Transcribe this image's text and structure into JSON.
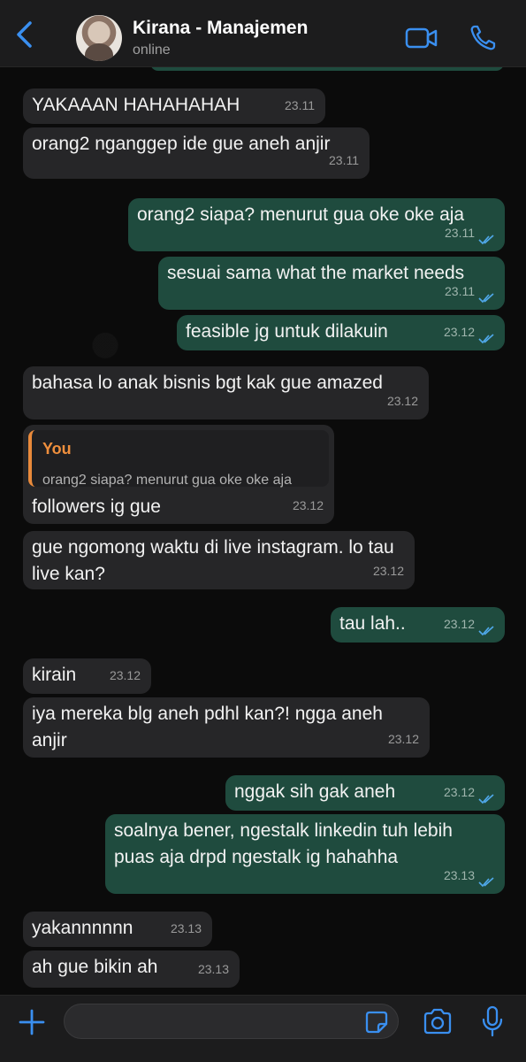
{
  "header": {
    "contact_name": "Kirana - Manajemen",
    "status": "online"
  },
  "colors": {
    "accent": "#3a8ff0",
    "incoming_bubble": "#262628",
    "outgoing_bubble": "#1f4b3e",
    "read_ticks": "#4fa7e8",
    "reply_accent": "#ef8f3d"
  },
  "messages": [
    {
      "dir": "in",
      "text": "YAKAAAN HAHAHAHAH",
      "time": "23.11"
    },
    {
      "dir": "in",
      "text": "orang2 nganggep ide gue aneh anjir",
      "time": "23.11"
    },
    {
      "dir": "out",
      "text": "orang2 siapa? menurut gua oke oke aja",
      "time": "23.11",
      "status": "read"
    },
    {
      "dir": "out",
      "text": "sesuai sama what the market needs",
      "time": "23.11",
      "status": "read"
    },
    {
      "dir": "out",
      "text": "feasible jg untuk dilakuin",
      "time": "23.12",
      "status": "read"
    },
    {
      "dir": "in",
      "text": "bahasa lo anak bisnis bgt kak gue amazed",
      "time": "23.12"
    },
    {
      "dir": "in",
      "reply_author": "You",
      "reply_text": "orang2 siapa? menurut gua oke oke aja",
      "text": "followers ig gue",
      "time": "23.12"
    },
    {
      "dir": "in",
      "text": "gue ngomong waktu di live instagram. lo tau live kan?",
      "time": "23.12"
    },
    {
      "dir": "out",
      "text": "tau lah..",
      "time": "23.12",
      "status": "read"
    },
    {
      "dir": "in",
      "text": "kirain",
      "time": "23.12"
    },
    {
      "dir": "in",
      "text": "iya mereka blg aneh pdhl kan?! ngga aneh anjir",
      "time": "23.12"
    },
    {
      "dir": "out",
      "text": "nggak sih gak aneh",
      "time": "23.12",
      "status": "read"
    },
    {
      "dir": "out",
      "text": "soalnya bener, ngestalk linkedin tuh lebih puas aja drpd ngestalk ig hahahha",
      "time": "23.13",
      "status": "read"
    },
    {
      "dir": "in",
      "text": "yakannnnnn",
      "time": "23.13"
    },
    {
      "dir": "in",
      "text": "ah gue bikin ah",
      "time": "23.13"
    }
  ],
  "input": {
    "placeholder": ""
  },
  "icons": {
    "back": "chevron-left-icon",
    "video": "video-camera-icon",
    "call": "phone-icon",
    "plus": "plus-icon",
    "sticker": "sticker-icon",
    "camera": "camera-icon",
    "mic": "microphone-icon"
  }
}
